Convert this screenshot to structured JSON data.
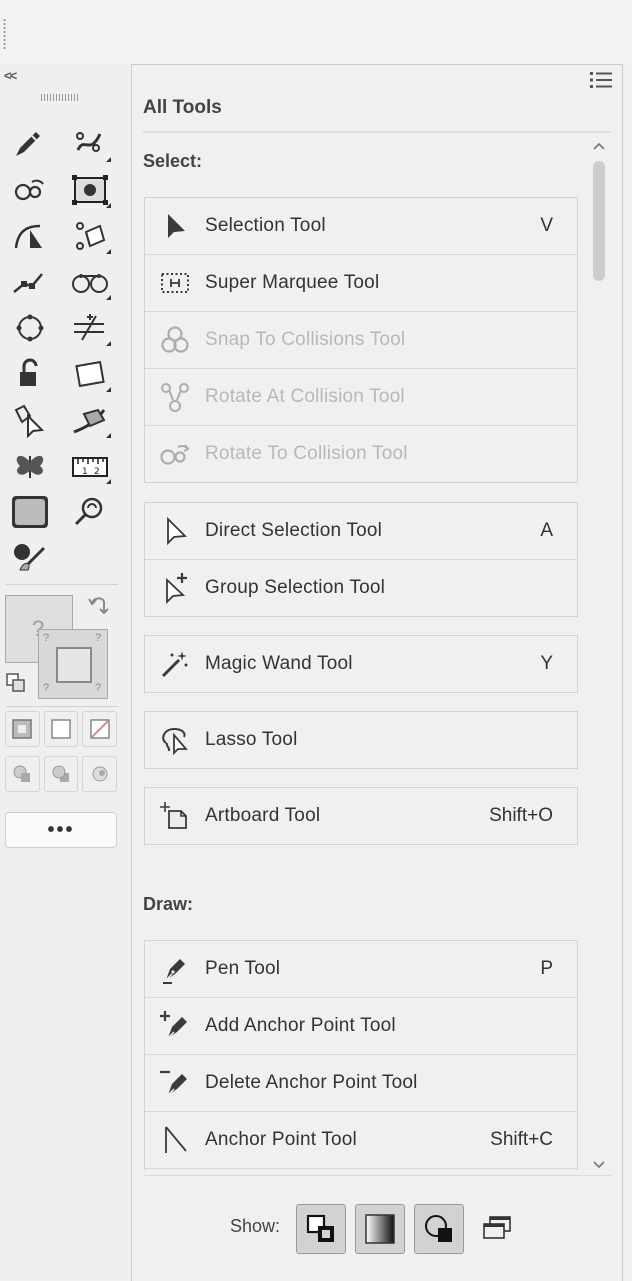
{
  "toolbar": {
    "collapse_label": "<<",
    "fill_placeholder": "?",
    "stroke_placeholder": "?",
    "more_label": "•••",
    "tools": [
      {
        "name": "pen-pencil-tool-icon"
      },
      {
        "name": "puppet-warp-tool-icon"
      },
      {
        "name": "rotate-to-collision-tool-icon"
      },
      {
        "name": "free-transform-tool-icon"
      },
      {
        "name": "direct-anchor-tool-icon"
      },
      {
        "name": "shape-builder-tool-icon"
      },
      {
        "name": "link-tool-icon"
      },
      {
        "name": "blend-tool-icon"
      },
      {
        "name": "circle-tool-icon"
      },
      {
        "name": "slice-tool-icon"
      },
      {
        "name": "unlock-tool-icon"
      },
      {
        "name": "artboard-rect-tool-icon"
      },
      {
        "name": "direct-selection-plus-tool-icon"
      },
      {
        "name": "perspective-tool-icon"
      },
      {
        "name": "symbol-butterfly-tool-icon"
      },
      {
        "name": "measure-ruler-tool-icon"
      },
      {
        "name": "texture-tool-icon"
      },
      {
        "name": "zoom-tool-icon"
      },
      {
        "name": "paint-brush-tool-icon"
      }
    ]
  },
  "panel": {
    "title": "All Tools",
    "sections": [
      {
        "title": "Select:",
        "groups": [
          [
            {
              "label": "Selection Tool",
              "key": "V",
              "icon": "selection-arrow-icon",
              "disabled": false
            },
            {
              "label": "Super Marquee Tool",
              "key": "",
              "icon": "marquee-icon",
              "disabled": false
            },
            {
              "label": "Snap To Collisions Tool",
              "key": "",
              "icon": "snap-collisions-icon",
              "disabled": true
            },
            {
              "label": "Rotate At Collision Tool",
              "key": "",
              "icon": "rotate-at-collision-icon",
              "disabled": true
            },
            {
              "label": "Rotate To Collision Tool",
              "key": "",
              "icon": "rotate-to-collision-icon",
              "disabled": true
            }
          ],
          [
            {
              "label": "Direct Selection Tool",
              "key": "A",
              "icon": "direct-selection-icon",
              "disabled": false
            },
            {
              "label": "Group Selection Tool",
              "key": "",
              "icon": "group-selection-icon",
              "disabled": false
            }
          ],
          [
            {
              "label": "Magic Wand Tool",
              "key": "Y",
              "icon": "magic-wand-icon",
              "disabled": false
            }
          ],
          [
            {
              "label": "Lasso Tool",
              "key": "",
              "icon": "lasso-icon",
              "disabled": false
            }
          ],
          [
            {
              "label": "Artboard Tool",
              "key": "Shift+O",
              "icon": "artboard-icon",
              "disabled": false
            }
          ]
        ]
      },
      {
        "title": "Draw:",
        "groups": [
          [
            {
              "label": "Pen Tool",
              "key": "P",
              "icon": "pen-icon",
              "disabled": false
            },
            {
              "label": "Add Anchor Point Tool",
              "key": "",
              "icon": "add-anchor-point-icon",
              "disabled": false
            },
            {
              "label": "Delete Anchor Point Tool",
              "key": "",
              "icon": "delete-anchor-point-icon",
              "disabled": false
            },
            {
              "label": "Anchor Point Tool",
              "key": "Shift+C",
              "icon": "anchor-point-icon",
              "disabled": false
            },
            {
              "label": "",
              "key": "",
              "icon": "",
              "disabled": false
            }
          ]
        ]
      }
    ],
    "show": {
      "label": "Show:",
      "buttons": [
        {
          "name": "show-fill-stroke-icon",
          "active": true
        },
        {
          "name": "show-gradient-icon",
          "active": true
        },
        {
          "name": "show-draw-mode-icon",
          "active": true
        },
        {
          "name": "show-screen-mode-icon",
          "active": false
        }
      ]
    }
  }
}
